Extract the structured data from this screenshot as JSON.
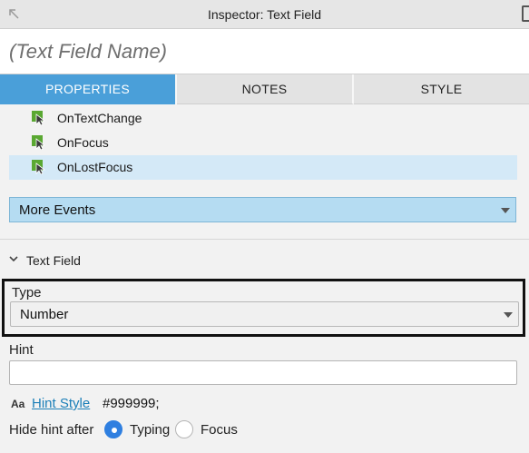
{
  "window": {
    "title": "Inspector: Text Field"
  },
  "name_field": {
    "placeholder": "(Text Field Name)"
  },
  "tabs": [
    {
      "label": "PROPERTIES",
      "active": true
    },
    {
      "label": "NOTES",
      "active": false
    },
    {
      "label": "STYLE",
      "active": false
    }
  ],
  "events": [
    {
      "label": "OnTextChange",
      "icon": "cursor-event-icon",
      "selected": false
    },
    {
      "label": "OnFocus",
      "icon": "cursor-event-icon",
      "selected": false
    },
    {
      "label": "OnLostFocus",
      "icon": "cursor-event-icon",
      "selected": true
    }
  ],
  "more_events": {
    "label": "More Events"
  },
  "section": {
    "label": "Text Field",
    "expanded": true
  },
  "type": {
    "label": "Type",
    "value": "Number"
  },
  "hint": {
    "label": "Hint",
    "value": ""
  },
  "hint_style": {
    "icon": "Aa",
    "link": "Hint Style",
    "color": "#999999;"
  },
  "hide_hint": {
    "label": "Hide hint after",
    "options": [
      {
        "label": "Typing",
        "checked": true
      },
      {
        "label": "Focus",
        "checked": false
      }
    ]
  },
  "colors": {
    "accent": "#4a9fd9",
    "selected_row": "#d4e9f7",
    "more_events_bg": "#b5dcf2",
    "link": "#1b7fb8",
    "radio_on": "#2f7fe0"
  }
}
